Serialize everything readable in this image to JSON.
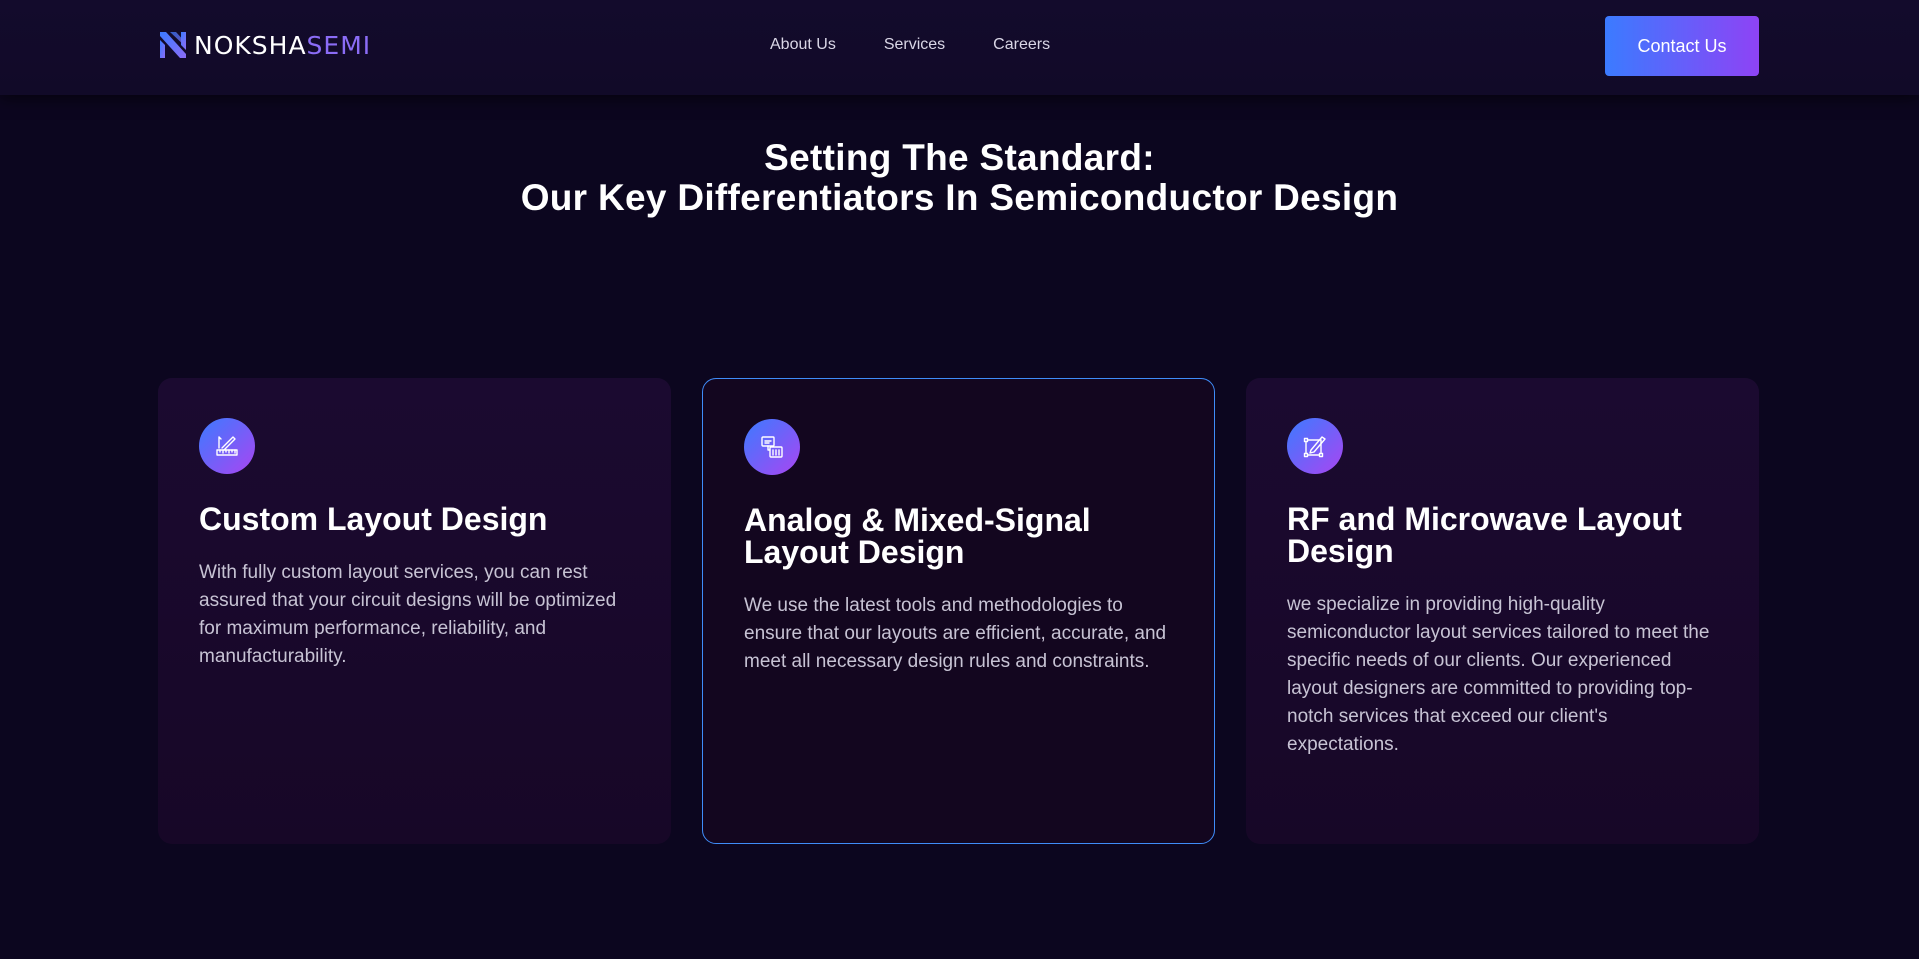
{
  "brand": {
    "name_part1": "NOKSHA",
    "name_part2": "SEMI"
  },
  "nav": {
    "items": [
      {
        "label": "About Us"
      },
      {
        "label": "Services"
      },
      {
        "label": "Careers"
      }
    ]
  },
  "cta": {
    "contact_label": "Contact Us"
  },
  "section": {
    "title_line1": "Setting The Standard:",
    "title_line2": "Our Key Differentiators In Semiconductor Design"
  },
  "cards": [
    {
      "icon": "ruler-pencil-icon",
      "title": "Custom Layout Design",
      "description": "With fully custom layout services, you can rest assured that your circuit designs will be optimized for maximum performance, reliability, and manufacturability."
    },
    {
      "icon": "circuit-chip-icon",
      "title": "Analog & Mixed-Signal Layout Design",
      "description": "We use the latest tools and methodologies to ensure that our layouts are efficient, accurate, and meet all necessary design rules and constraints."
    },
    {
      "icon": "vector-edit-icon",
      "title": "RF and Microwave Layout Design",
      "description": "we specialize in providing high-quality semiconductor layout services tailored to meet the specific needs of our clients. Our experienced layout designers are committed to providing top-notch services that exceed our client's expectations."
    }
  ],
  "colors": {
    "background": "#0c061f",
    "accent_blue": "#3b7bff",
    "accent_purple": "#8e43f5",
    "brand_purple": "#8b6cf6",
    "active_border": "#3f8cf8"
  }
}
